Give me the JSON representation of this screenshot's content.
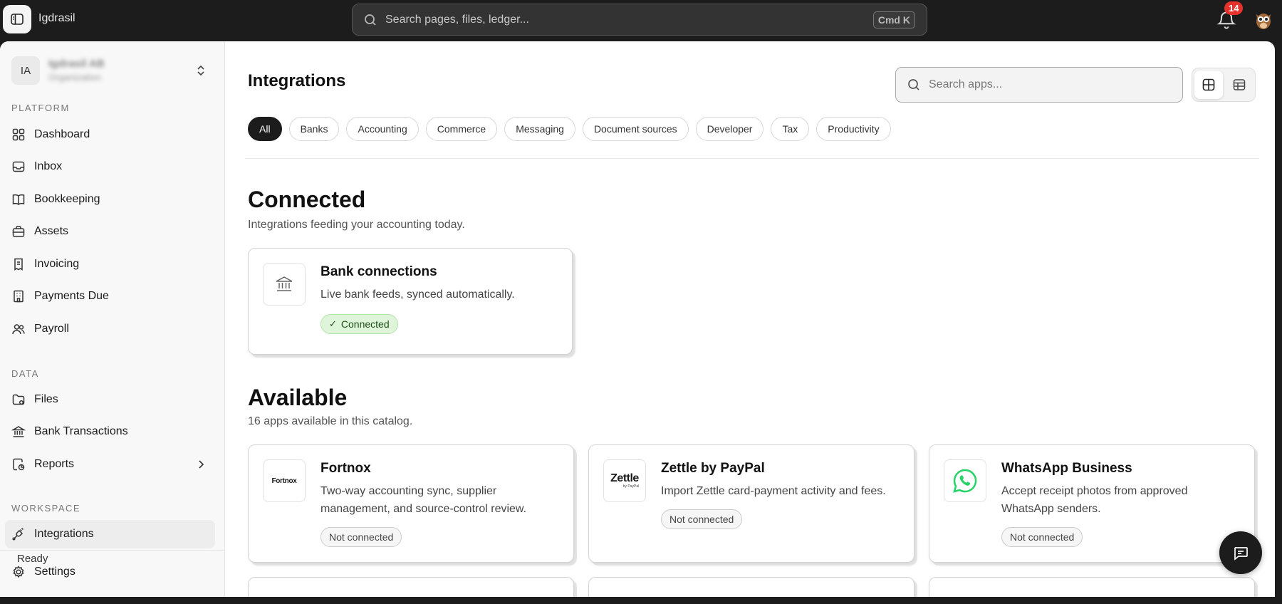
{
  "topbar": {
    "app_name": "Igdrasil",
    "search_placeholder": "Search pages, files, ledger...",
    "search_shortcut": "Cmd K",
    "notification_count": "14"
  },
  "sidebar": {
    "org": {
      "initials": "IA",
      "name": "Igdrasil AB",
      "subtitle": "Organization"
    },
    "sections": {
      "platform": "PLATFORM",
      "data": "DATA",
      "workspace": "WORKSPACE"
    },
    "items": [
      {
        "label": "Dashboard",
        "icon": "dashboard-icon"
      },
      {
        "label": "Inbox",
        "icon": "inbox-icon"
      },
      {
        "label": "Bookkeeping",
        "icon": "book-icon"
      },
      {
        "label": "Assets",
        "icon": "briefcase-icon"
      },
      {
        "label": "Invoicing",
        "icon": "receipt-icon"
      },
      {
        "label": "Payments Due",
        "icon": "building-icon"
      },
      {
        "label": "Payroll",
        "icon": "users-icon"
      },
      {
        "label": "Files",
        "icon": "folder-icon"
      },
      {
        "label": "Bank Transactions",
        "icon": "bank-icon"
      },
      {
        "label": "Reports",
        "icon": "report-icon"
      },
      {
        "label": "Integrations",
        "icon": "plug-icon"
      },
      {
        "label": "Settings",
        "icon": "gear-icon"
      }
    ],
    "status": "Ready"
  },
  "main": {
    "title": "Integrations",
    "search_placeholder": "Search apps...",
    "filters": [
      "All",
      "Banks",
      "Accounting",
      "Commerce",
      "Messaging",
      "Document sources",
      "Developer",
      "Tax",
      "Productivity"
    ],
    "connected": {
      "heading": "Connected",
      "subtitle": "Integrations feeding your accounting today.",
      "cards": [
        {
          "title": "Bank connections",
          "description": "Live bank feeds, synced automatically.",
          "status": "Connected"
        }
      ]
    },
    "available": {
      "heading": "Available",
      "subtitle": "16 apps available in this catalog.",
      "cards": [
        {
          "title": "Fortnox",
          "logo_text": "Fortnox",
          "description": "Two-way accounting sync, supplier management, and source-control review.",
          "status": "Not connected"
        },
        {
          "title": "Zettle by PayPal",
          "logo_text": "Zettle",
          "logo_subtext": "by PayPal",
          "description": "Import Zettle card-payment activity and fees.",
          "status": "Not connected"
        },
        {
          "title": "WhatsApp Business",
          "description": "Accept receipt photos from approved WhatsApp senders.",
          "status": "Not connected"
        }
      ]
    }
  },
  "colors": {
    "topbar_bg": "#1c1c1c",
    "badge": "#e5322d",
    "connected_bg": "#dff5da",
    "whatsapp_green": "#25d366"
  }
}
